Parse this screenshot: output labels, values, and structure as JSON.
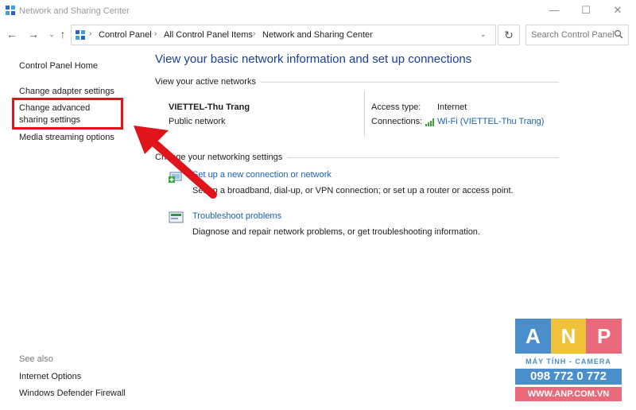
{
  "window": {
    "title": "Network and Sharing Center",
    "minimize_glyph": "—",
    "maximize_glyph": "☐",
    "close_glyph": "✕"
  },
  "navigation": {
    "back_glyph": "←",
    "forward_glyph": "→",
    "recent_glyph": "⌄",
    "up_glyph": "↑",
    "breadcrumbs": [
      "Control Panel",
      "All Control Panel Items",
      "Network and Sharing Center"
    ],
    "separator": "›",
    "dropdown_glyph": "⌄",
    "refresh_glyph": "↻",
    "search_placeholder": "Search Control Panel"
  },
  "sidebar": {
    "items": [
      {
        "label": "Control Panel Home"
      },
      {
        "label": "Change adapter settings"
      },
      {
        "label": "Change advanced sharing settings"
      },
      {
        "label": "Media streaming options"
      }
    ],
    "see_also_label": "See also",
    "see_also_items": [
      {
        "label": "Internet Options"
      },
      {
        "label": "Windows Defender Firewall"
      }
    ]
  },
  "main": {
    "title": "View your basic network information and set up connections",
    "active_networks_heading": "View your active networks",
    "network": {
      "name": "VIETTEL-Thu Trang",
      "category": "Public network",
      "access_type_label": "Access type:",
      "access_type_value": "Internet",
      "connections_label": "Connections:",
      "connections_value": "Wi-Fi (VIETTEL-Thu Trang)"
    },
    "change_settings_heading": "Change your networking settings",
    "tasks": [
      {
        "link": "Set up a new connection or network",
        "description": "Set up a broadband, dial-up, or VPN connection; or set up a router or access point."
      },
      {
        "link": "Troubleshoot problems",
        "description": "Diagnose and repair network problems, or get troubleshooting information."
      }
    ]
  },
  "watermark": {
    "letters": [
      "A",
      "N",
      "P"
    ],
    "tile_colors": [
      "#4a8fcb",
      "#f0c23a",
      "#e86a7b"
    ],
    "subtitle": "MÁY TÍNH - CAMERA",
    "phone": "098 772 0 772",
    "website": "WWW.ANP.COM.VN"
  },
  "colors": {
    "link": "#1a5fb4",
    "title": "#1a3f9b",
    "highlight": "#e0141b"
  }
}
